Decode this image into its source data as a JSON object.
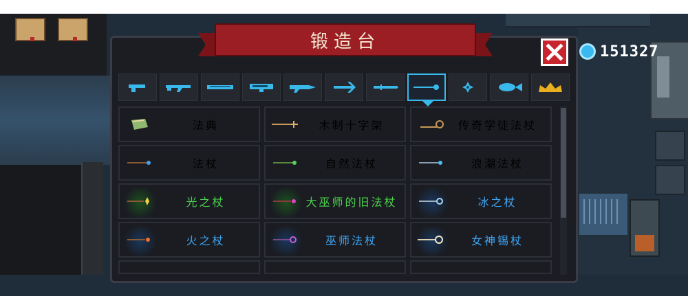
{
  "header": {
    "title": "锻造台"
  },
  "currency": {
    "icon": "gem-icon",
    "amount": "151327",
    "color": "#3ab8f0"
  },
  "colors": {
    "accent": "#39b8ea",
    "banner": "#9b1e24",
    "close": "#c8262e"
  },
  "tabs": [
    {
      "icon": "pistol-icon",
      "selected": false
    },
    {
      "icon": "rifle-icon",
      "selected": false
    },
    {
      "icon": "shotgun-icon",
      "selected": false
    },
    {
      "icon": "launcher-icon",
      "selected": false
    },
    {
      "icon": "laser-gun-icon",
      "selected": false
    },
    {
      "icon": "crossbow-icon",
      "selected": false
    },
    {
      "icon": "blade-icon",
      "selected": false
    },
    {
      "icon": "staff-icon",
      "selected": true
    },
    {
      "icon": "shuriken-icon",
      "selected": false
    },
    {
      "icon": "fish-icon",
      "selected": false
    },
    {
      "icon": "crown-icon",
      "selected": false
    }
  ],
  "items": [
    {
      "name": "法典",
      "icon": "tome-icon",
      "text_color": "#ffffff",
      "glow": "#3a3a3a"
    },
    {
      "name": "木制十字架",
      "icon": "cross-staff-icon",
      "text_color": "#ffffff",
      "glow": "#3a3a3a"
    },
    {
      "name": "传奇学徒法杖",
      "icon": "coil-staff-icon",
      "text_color": "#ffffff",
      "glow": "#3a3a3a"
    },
    {
      "name": "法杖",
      "icon": "staff-icon",
      "text_color": "#ffffff",
      "glow": "#3a3a3a"
    },
    {
      "name": "自然法杖",
      "icon": "nature-staff-icon",
      "text_color": "#ffffff",
      "glow": "#3a3a3a"
    },
    {
      "name": "浪潮法杖",
      "icon": "wave-staff-icon",
      "text_color": "#ffffff",
      "glow": "#3a3a3a"
    },
    {
      "name": "光之杖",
      "icon": "light-staff-icon",
      "text_color": "#4cd04c",
      "glow": "#1e7a1e"
    },
    {
      "name": "大巫师的旧法杖",
      "icon": "archmage-staff-icon",
      "text_color": "#4cd04c",
      "glow": "#1e7a1e"
    },
    {
      "name": "冰之杖",
      "icon": "ice-staff-icon",
      "text_color": "#3fa4f0",
      "glow": "#1a4d8a"
    },
    {
      "name": "火之杖",
      "icon": "fire-staff-icon",
      "text_color": "#3fa4f0",
      "glow": "#1a4d8a"
    },
    {
      "name": "巫师法杖",
      "icon": "wizard-staff-icon",
      "text_color": "#3fa4f0",
      "glow": "#1a4d8a"
    },
    {
      "name": "女神锡杖",
      "icon": "goddess-staff-icon",
      "text_color": "#3fa4f0",
      "glow": "#1a4d8a"
    }
  ]
}
